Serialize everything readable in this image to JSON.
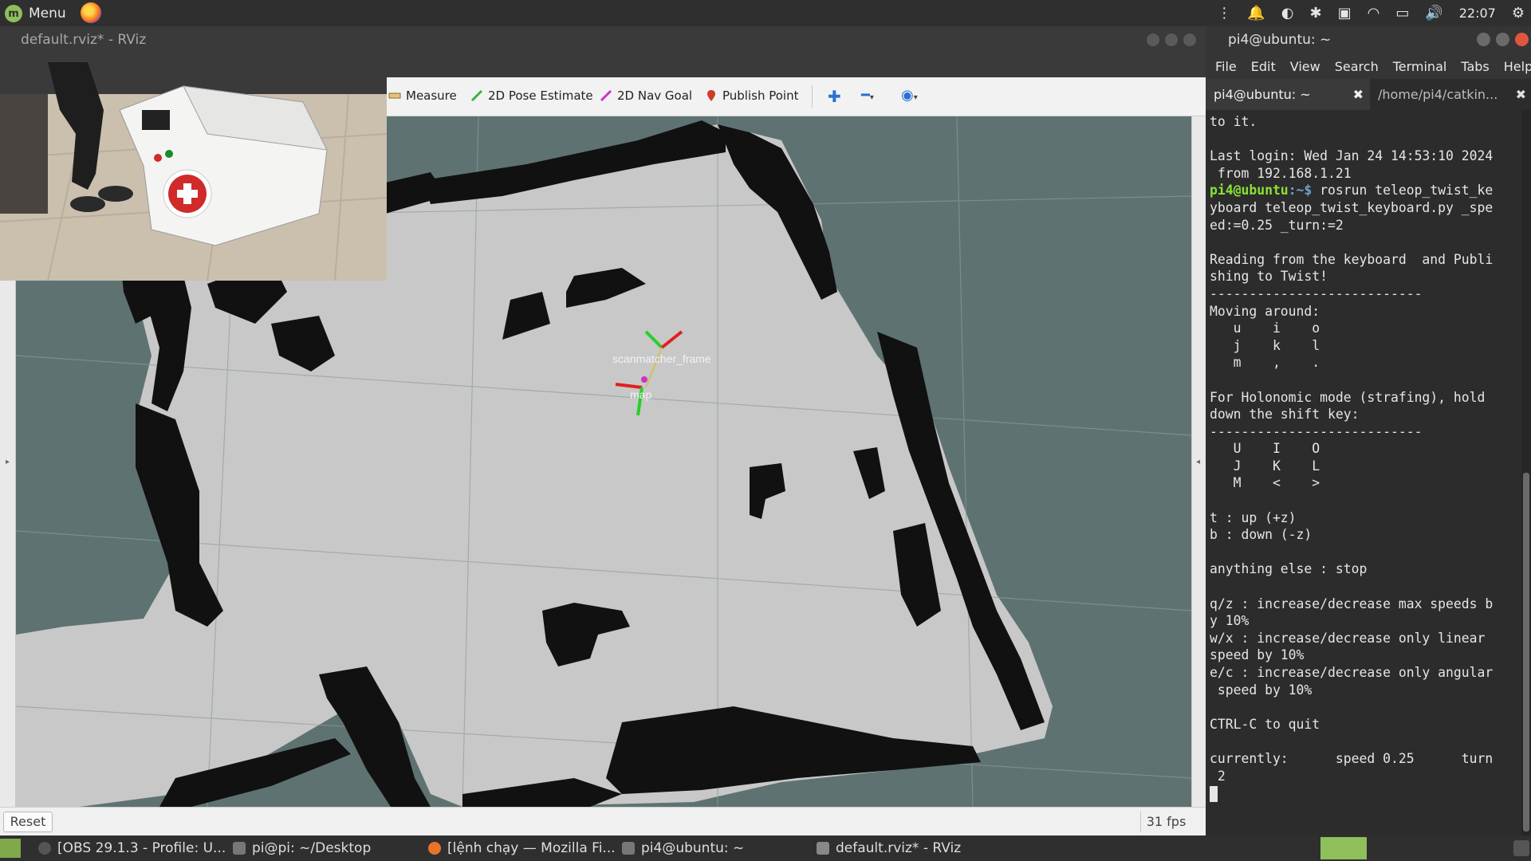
{
  "top_panel": {
    "menu_label": "Menu",
    "time": "22:07",
    "icons": [
      "notification-bell-icon",
      "app-indicator-icon",
      "bluetooth-icon",
      "network-card-icon",
      "wifi-icon",
      "battery-icon",
      "volume-icon",
      "settings-gear-icon"
    ]
  },
  "rviz": {
    "title": "default.rviz* - RViz",
    "toolbar": {
      "measure": "Measure",
      "pose_estimate": "2D Pose Estimate",
      "nav_goal": "2D Nav Goal",
      "publish_point": "Publish Point"
    },
    "frames": {
      "label_a": "scanmatcher_frame",
      "label_b": "map"
    },
    "reset_label": "Reset",
    "fps_label": "31 fps",
    "colors": {
      "background": "#5e7272",
      "free": "#c8c8c8",
      "occupied": "#111111",
      "grid": "#8a9a9a"
    }
  },
  "terminal": {
    "title": "pi4@ubuntu: ~",
    "menu": [
      "File",
      "Edit",
      "View",
      "Search",
      "Terminal",
      "Tabs",
      "Help"
    ],
    "tabs": [
      {
        "label": "pi4@ubuntu: ~"
      },
      {
        "label": "/home/pi4/catkin..."
      }
    ],
    "lines_before_prompt": [
      "to it.",
      "",
      "Last login: Wed Jan 24 14:53:10 2024",
      " from 192.168.1.21"
    ],
    "prompt_user": "pi4@ubuntu",
    "prompt_path": ":~$ ",
    "command": "rosrun teleop_twist_ke",
    "lines_after_prompt": [
      "yboard teleop_twist_keyboard.py _spe",
      "ed:=0.25 _turn:=2",
      "",
      "Reading from the keyboard  and Publi",
      "shing to Twist!",
      "---------------------------",
      "Moving around:",
      "   u    i    o",
      "   j    k    l",
      "   m    ,    .",
      "",
      "For Holonomic mode (strafing), hold",
      "down the shift key:",
      "---------------------------",
      "   U    I    O",
      "   J    K    L",
      "   M    <    >",
      "",
      "t : up (+z)",
      "b : down (-z)",
      "",
      "anything else : stop",
      "",
      "q/z : increase/decrease max speeds b",
      "y 10%",
      "w/x : increase/decrease only linear",
      "speed by 10%",
      "e/c : increase/decrease only angular",
      " speed by 10%",
      "",
      "CTRL-C to quit",
      "",
      "currently:      speed 0.25      turn",
      " 2"
    ]
  },
  "taskbar": {
    "items": [
      {
        "label": "[OBS 29.1.3 - Profile: U..."
      },
      {
        "label": "pi@pi: ~/Desktop"
      },
      {
        "label": "[lệnh chạy — Mozilla Fi..."
      },
      {
        "label": "pi4@ubuntu: ~"
      },
      {
        "label": "default.rviz* - RViz"
      }
    ]
  }
}
